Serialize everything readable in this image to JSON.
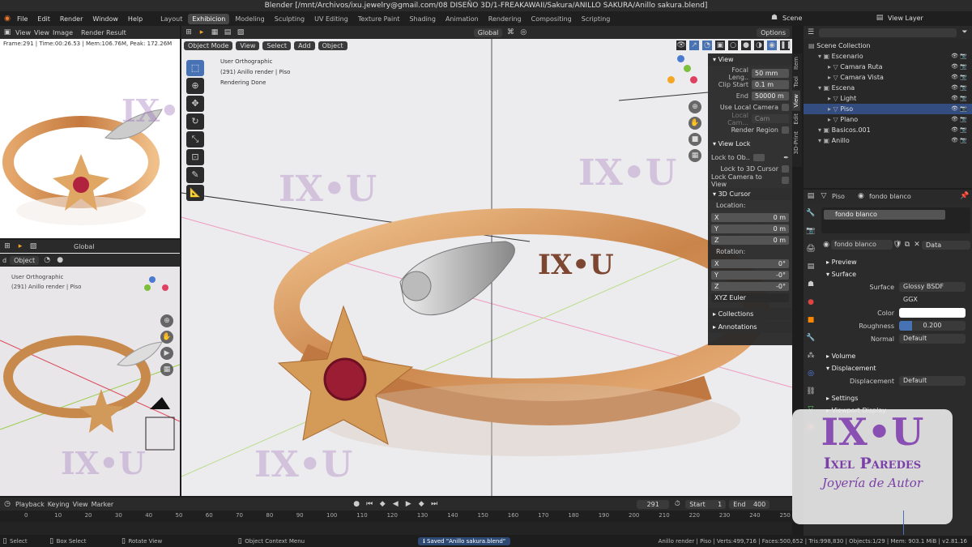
{
  "window_title": "Blender [/mnt/Archivos/ixu.jewelry@gmail.com/08 DISEÑO 3D/1-FREAKAWAII/Sakura/ANILLO SAKURA/Anillo sakura.blend]",
  "menu": [
    "File",
    "Edit",
    "Render",
    "Window",
    "Help"
  ],
  "workspaces": [
    "Layout",
    "Exhibicion",
    "Modeling",
    "Sculpting",
    "UV Editing",
    "Texture Paint",
    "Shading",
    "Animation",
    "Rendering",
    "Compositing",
    "Scripting"
  ],
  "active_workspace": "Exhibicion",
  "scene_label": "Scene",
  "view_layer_label": "View Layer",
  "render_panel": {
    "menu": [
      "View",
      "View",
      "Image"
    ],
    "result": "Render Result",
    "stats": "Frame:291 | Time:00:26.53 | Mem:106.76M, Peak: 172.26M"
  },
  "small_viewport": {
    "mode_tail": "d",
    "obj": "Object",
    "orient": "Global",
    "info1": "User Orthographic",
    "info2": "(291) Anillo render | Piso"
  },
  "main_viewport": {
    "mode": "Object Mode",
    "menu": [
      "View",
      "Select",
      "Add",
      "Object"
    ],
    "orient": "Global",
    "options": "Options",
    "info1": "User Orthographic",
    "info2": "(291) Anillo render | Piso",
    "info3": "Rendering Done"
  },
  "watermark": "IX•U",
  "npanel": {
    "view_header": "View",
    "focal_label": "Focal Leng..",
    "focal_value": "50 mm",
    "clip_start_label": "Clip Start",
    "clip_start_value": "0.1 m",
    "end_label": "End",
    "end_value": "50000 m",
    "use_local_camera": "Use Local Camera",
    "local_cam_label": "Local Cam...",
    "local_cam_value": "Cam",
    "render_region": "Render Region",
    "view_lock_header": "View Lock",
    "lock_to_obj": "Lock to Ob..",
    "lock_cursor": "Lock to 3D Cursor",
    "lock_camera": "Lock Camera to View",
    "cursor_header": "3D Cursor",
    "location": "Location:",
    "rotation": "Rotation:",
    "loc": [
      {
        "axis": "X",
        "value": "0 m"
      },
      {
        "axis": "Y",
        "value": "0 m"
      },
      {
        "axis": "Z",
        "value": "0 m"
      }
    ],
    "rot": [
      {
        "axis": "X",
        "value": "0°"
      },
      {
        "axis": "Y",
        "value": "-0°"
      },
      {
        "axis": "Z",
        "value": "-0°"
      }
    ],
    "rot_mode": "XYZ Euler",
    "collections": "Collections",
    "annotations": "Annotations",
    "tabs": [
      "Item",
      "Tool",
      "View",
      "Edit",
      "3D-Print"
    ]
  },
  "outliner": {
    "items": [
      {
        "name": "Scene Collection",
        "indent": 0
      },
      {
        "name": "Escenario",
        "indent": 1
      },
      {
        "name": "Camara Ruta",
        "indent": 2
      },
      {
        "name": "Camara Vista",
        "indent": 2
      },
      {
        "name": "Escena",
        "indent": 1
      },
      {
        "name": "Light",
        "indent": 2
      },
      {
        "name": "Piso",
        "indent": 2,
        "selected": true
      },
      {
        "name": "Plano",
        "indent": 2
      },
      {
        "name": "Basicos.001",
        "indent": 1
      },
      {
        "name": "Anillo",
        "indent": 1
      }
    ]
  },
  "properties": {
    "object": "Piso",
    "material": "fondo blanco",
    "slot": "fondo blanco",
    "mat_field": "fondo blanco",
    "data": "Data",
    "preview": "Preview",
    "surface": "Surface",
    "rows": [
      {
        "label": "Surface",
        "value": "Glossy BSDF"
      },
      {
        "label": "",
        "value": "GGX"
      },
      {
        "label": "Color",
        "value": ""
      },
      {
        "label": "Roughness",
        "value": "0.200"
      },
      {
        "label": "Normal",
        "value": "Default"
      }
    ],
    "volume": "Volume",
    "displacement_header": "Displacement",
    "displacement_label": "Displacement",
    "displacement_value": "Default",
    "settings": "Settings",
    "viewport_display": "Viewport Display"
  },
  "logo": {
    "mark": "IX•U",
    "name": "Ixel Paredes",
    "tagline": "Joyería de Autor"
  },
  "timeline": {
    "menu": [
      "Playback",
      "Keying",
      "View",
      "Marker"
    ],
    "current": "291",
    "start_label": "Start",
    "start": "1",
    "end_label": "End",
    "end": "400",
    "ticks": [
      "0",
      "10",
      "20",
      "30",
      "40",
      "50",
      "60",
      "70",
      "80",
      "90",
      "100",
      "110",
      "120",
      "130",
      "140",
      "150",
      "160",
      "170",
      "180",
      "190",
      "200",
      "210",
      "220",
      "230",
      "240",
      "250"
    ]
  },
  "status": {
    "select": "Select",
    "box_select": "Box Select",
    "rotate": "Rotate View",
    "context": "Object Context Menu",
    "saved": "Saved \"Anillo sakura.blend\"",
    "stats": "Anillo render | Piso | Verts:499,716 | Faces:500,652 | Tris:998,830 | Objects:1/29 | Mem: 903.1 MiB | v2.81.16"
  }
}
